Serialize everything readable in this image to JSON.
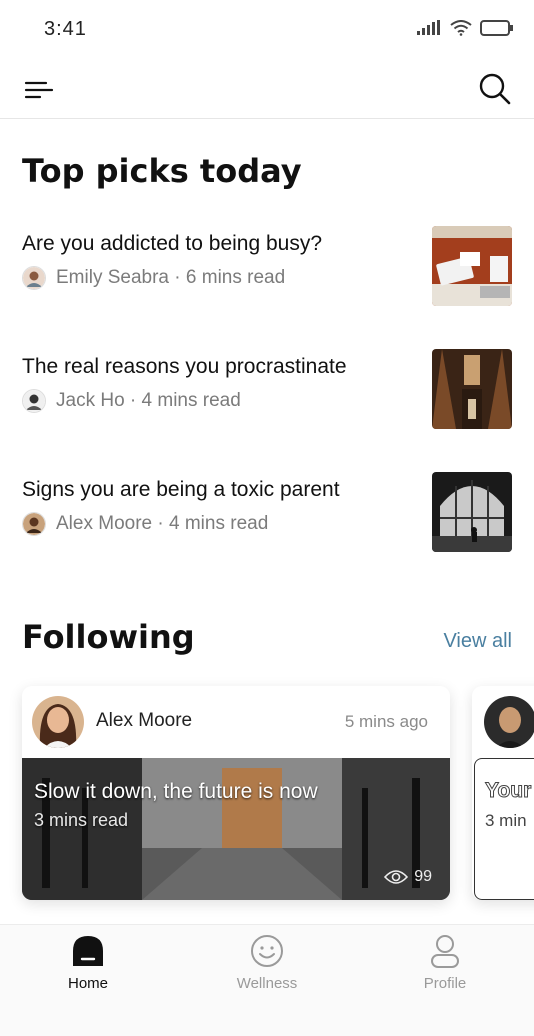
{
  "status_bar": {
    "time": "3:41"
  },
  "sections": {
    "top_picks_title": "Top picks today",
    "following_title": "Following",
    "view_all_label": "View all"
  },
  "picks": [
    {
      "headline": "Are you addicted to being busy?",
      "author": "Emily Seabra",
      "read_time": "6 mins read"
    },
    {
      "headline": "The real reasons you procrastinate",
      "author": "Jack Ho",
      "read_time": "4 mins read"
    },
    {
      "headline": "Signs you are being a toxic parent",
      "author": "Alex Moore",
      "read_time": "4 mins read"
    }
  ],
  "following_cards": [
    {
      "author": "Alex Moore",
      "posted": "5 mins ago",
      "title": "Slow it down, the future is now",
      "read_time": "3 mins read",
      "views": "99"
    },
    {
      "title": "Your",
      "read_time": "3 min"
    }
  ],
  "bottom_nav": [
    {
      "label": "Home",
      "icon": "home-icon",
      "active": true
    },
    {
      "label": "Wellness",
      "icon": "smile-icon",
      "active": false
    },
    {
      "label": "Profile",
      "icon": "user-icon",
      "active": false
    }
  ],
  "colors": {
    "accent": "#4a7fa0",
    "text": "#111111",
    "muted": "#7b7b7b"
  }
}
